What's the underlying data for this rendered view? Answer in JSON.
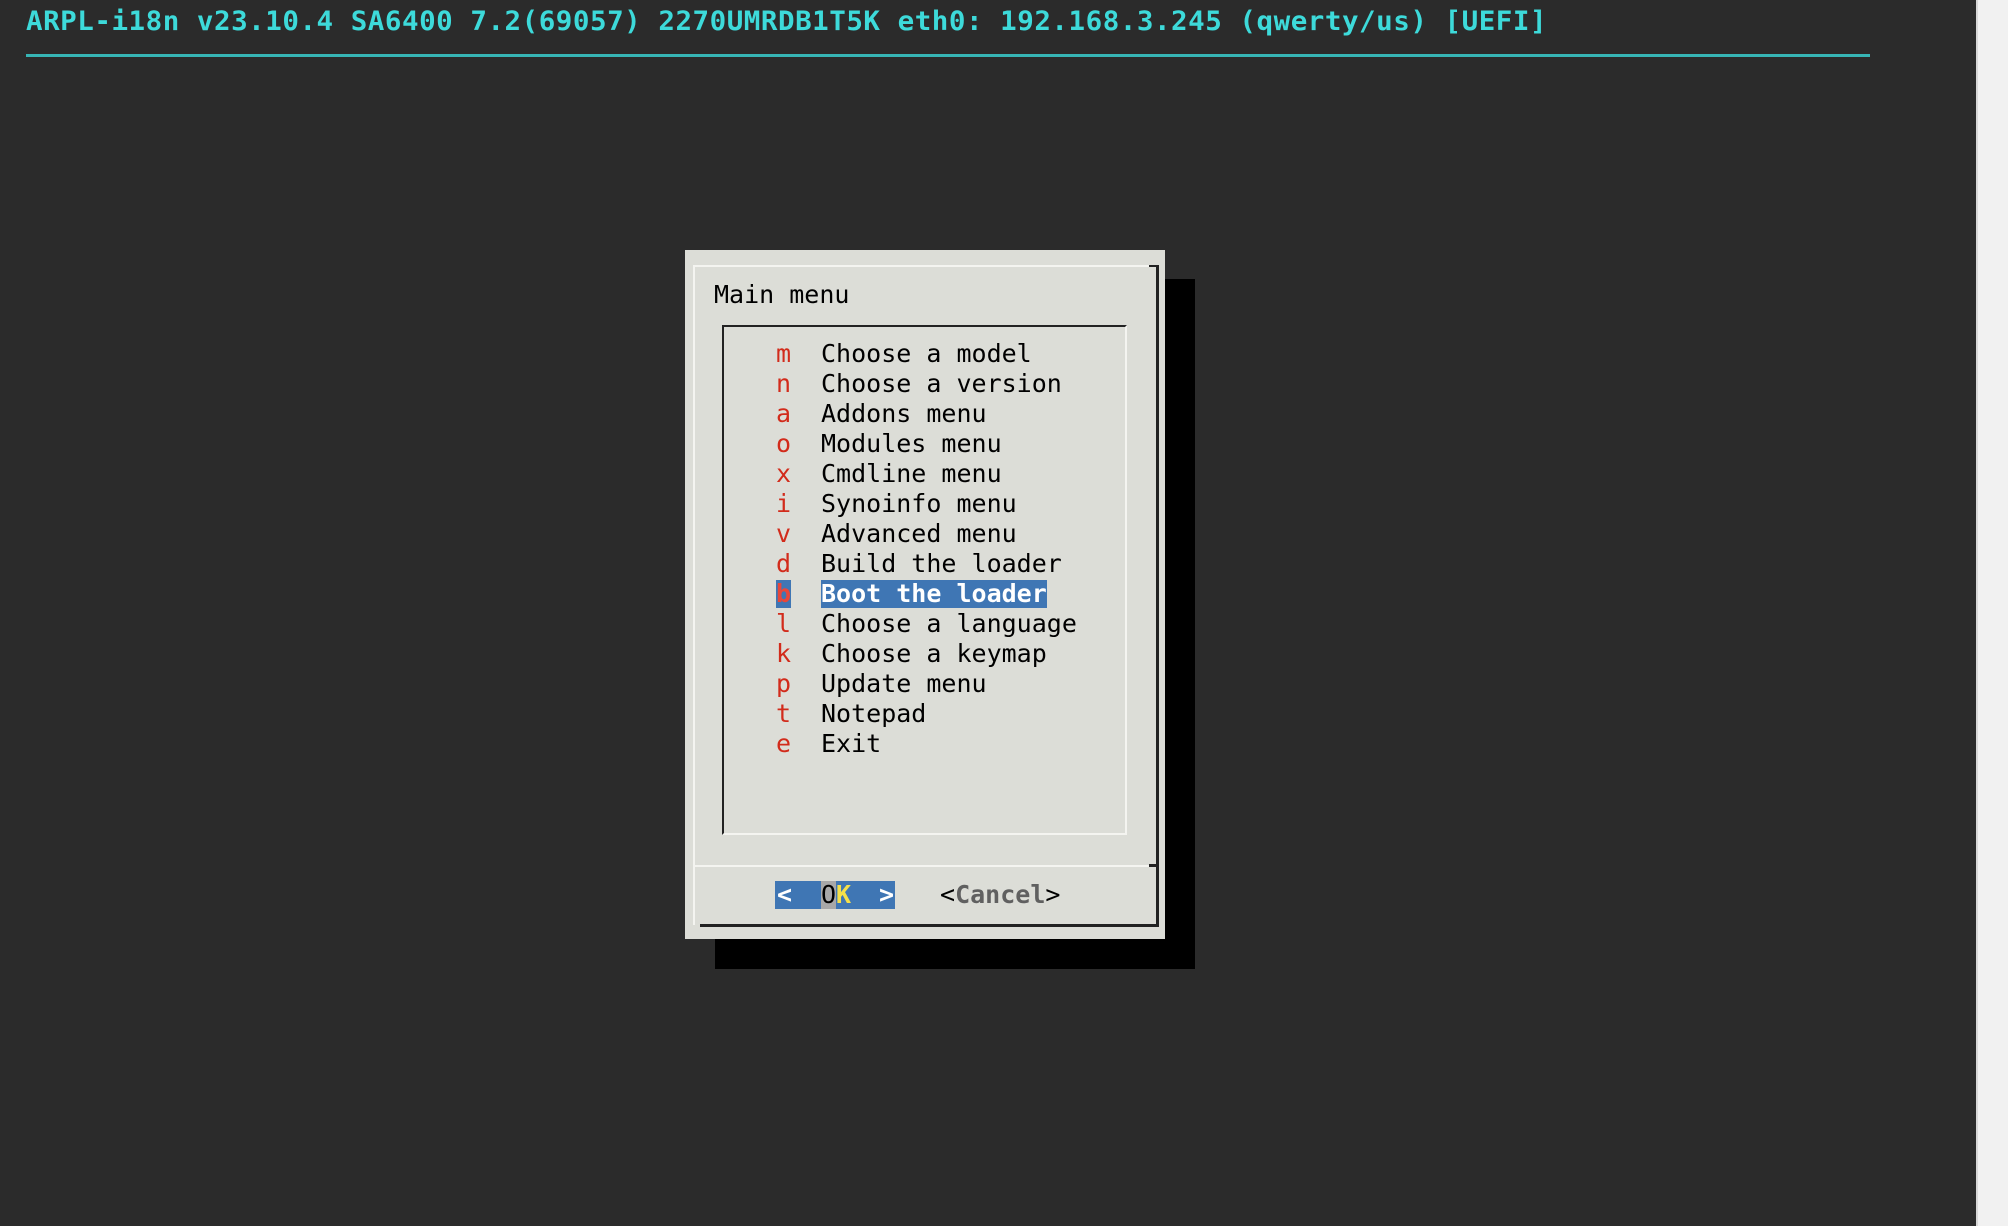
{
  "header": {
    "title": "ARPL-i18n v23.10.4 SA6400 7.2(69057) 2270UMRDB1T5K eth0: 192.168.3.245 (qwerty/us) [UEFI]"
  },
  "dialog": {
    "title": "Main menu",
    "items": [
      {
        "key": "m",
        "label": "Choose a model"
      },
      {
        "key": "n",
        "label": "Choose a version"
      },
      {
        "key": "a",
        "label": "Addons menu"
      },
      {
        "key": "o",
        "label": "Modules menu"
      },
      {
        "key": "x",
        "label": "Cmdline menu"
      },
      {
        "key": "i",
        "label": "Synoinfo menu"
      },
      {
        "key": "v",
        "label": "Advanced menu"
      },
      {
        "key": "d",
        "label": "Build the loader"
      },
      {
        "key": "b",
        "label": "Boot the loader",
        "selected": true
      },
      {
        "key": "l",
        "label": "Choose a language"
      },
      {
        "key": "k",
        "label": "Choose a keymap"
      },
      {
        "key": "p",
        "label": "Update menu"
      },
      {
        "key": "t",
        "label": "Notepad"
      },
      {
        "key": "e",
        "label": "Exit"
      }
    ],
    "buttons": {
      "ok": {
        "left": "<",
        "o": "O",
        "k": "K",
        "right": ">"
      },
      "cancel": {
        "open": "<",
        "label": "Cancel",
        "close": ">"
      }
    }
  },
  "colors": {
    "background": "#2b2b2b",
    "header": "#3ddada",
    "dialog": "#dcddd7",
    "hotkey": "#d22b1b",
    "selection": "#3f76b4"
  }
}
